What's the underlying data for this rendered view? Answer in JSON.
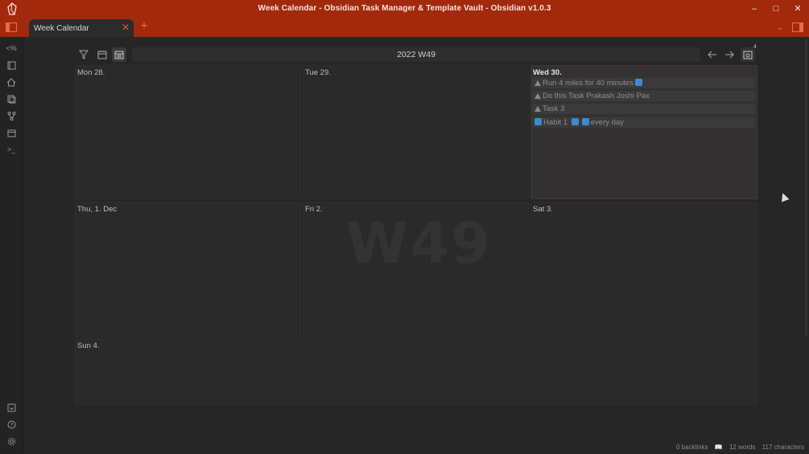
{
  "window": {
    "title": "Week Calendar - Obsidian Task Manager & Template Vault - Obsidian v1.0.3"
  },
  "tabs": [
    {
      "label": "Week Calendar"
    }
  ],
  "toolbar": {
    "week_label": "2022 W49",
    "badge_count": "4"
  },
  "days": [
    {
      "label": "Mon 28."
    },
    {
      "label": "Tue 29."
    },
    {
      "label": "Wed 30."
    },
    {
      "label": "Thu, 1. Dec"
    },
    {
      "label": "Fri 2."
    },
    {
      "label": "Sat 3."
    },
    {
      "label": "Sun 4."
    }
  ],
  "watermark": "W49",
  "tasks": [
    {
      "text": "Run 4 miles for 40 minutes"
    },
    {
      "text": "Do this Task Prakash Joshi Pax"
    },
    {
      "text": "Task 3"
    },
    {
      "text_a": "Habit 1",
      "text_b": "every day"
    }
  ],
  "status": {
    "backlinks": "0 backlinks",
    "words": "12 words",
    "characters": "117 characters"
  },
  "colors": {
    "accent": "#a3290c",
    "badge": "#3b8ad6"
  }
}
